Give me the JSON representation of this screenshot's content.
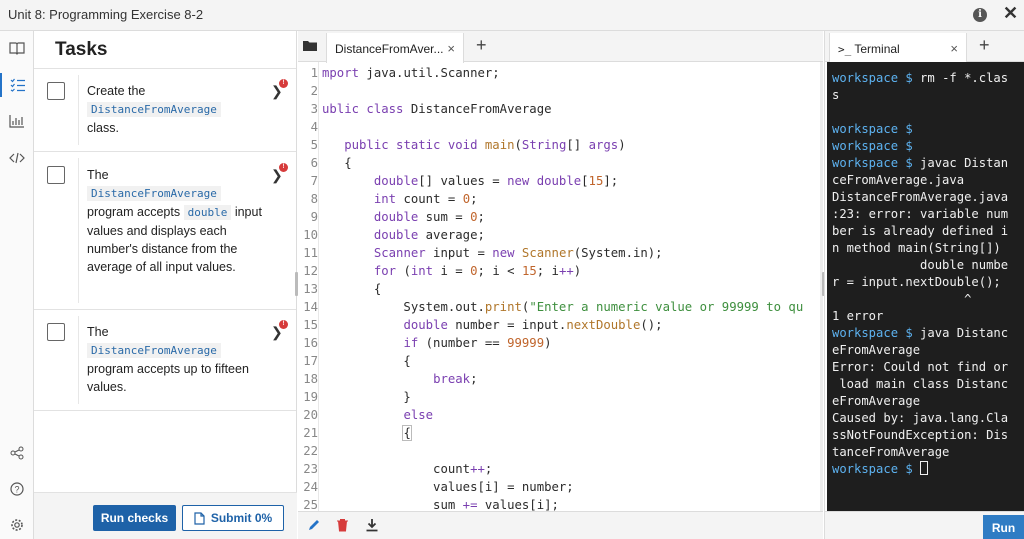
{
  "window": {
    "title": "Unit 8: Programming Exercise 8-2"
  },
  "icons": {
    "info": "info-icon",
    "close": "close-icon",
    "rail": [
      "book-icon",
      "tasks-list-icon",
      "chart-icon",
      "code-icon",
      "share-icon",
      "help-icon",
      "settings-icon"
    ]
  },
  "tasks": {
    "heading": "Tasks",
    "items": [
      {
        "pre": "Create the",
        "code": "DistanceFromAverage",
        "post": "class.",
        "badge": "!"
      },
      {
        "pre": "The",
        "code": "DistanceFromAverage",
        "mid": "program accepts",
        "code2": "double",
        "post": "input values and displays each number's distance from the average of all input values.",
        "badge": "!"
      },
      {
        "pre": "The",
        "code": "DistanceFromAverage",
        "post": "program accepts up to fifteen values.",
        "badge": "!"
      }
    ],
    "run_checks_label": "Run checks",
    "submit_label": "Submit 0%"
  },
  "editor": {
    "tab_label": "DistanceFromAver...",
    "tab_close": "×",
    "add_tab": "+",
    "line_numbers": [
      "1",
      "2",
      "3",
      "4",
      "5",
      "6",
      "7",
      "8",
      "9",
      "10",
      "11",
      "12",
      "13",
      "14",
      "15",
      "16",
      "17",
      "18",
      "19",
      "20",
      "21",
      "22",
      "23",
      "24",
      "25"
    ]
  },
  "terminal": {
    "tab_label": "Terminal",
    "tab_prefix": ">_",
    "tab_close": "×",
    "add_tab": "+",
    "prompt": "workspace $",
    "lines": [
      {
        "prompt": true,
        "text": " rm -f *.clas"
      },
      {
        "text": "s"
      },
      {
        "text": ""
      },
      {
        "prompt": true,
        "text": ""
      },
      {
        "prompt": true,
        "text": ""
      },
      {
        "prompt": true,
        "text": " javac Distan"
      },
      {
        "text": "ceFromAverage.java"
      },
      {
        "text": "DistanceFromAverage.java"
      },
      {
        "text": ":23: error: variable num"
      },
      {
        "text": "ber is already defined i"
      },
      {
        "text": "n method main(String[])"
      },
      {
        "text": "            double numbe"
      },
      {
        "text": "r = input.nextDouble();"
      },
      {
        "text": "                  ^"
      },
      {
        "text": "1 error"
      },
      {
        "prompt": true,
        "text": " java Distanc"
      },
      {
        "text": "eFromAverage"
      },
      {
        "text": "Error: Could not find or"
      },
      {
        "text": " load main class Distanc"
      },
      {
        "text": "eFromAverage"
      },
      {
        "text": "Caused by: java.lang.Cla"
      },
      {
        "text": "ssNotFoundException: Dis"
      },
      {
        "text": "tanceFromAverage"
      },
      {
        "prompt": true,
        "text": " ",
        "cursor": true
      }
    ],
    "run_label": "Run"
  },
  "colors": {
    "accent": "#1e62a8",
    "terminal_bg": "#1e1e1e",
    "prompt": "#5db2f0",
    "badge": "#d63b3b"
  }
}
